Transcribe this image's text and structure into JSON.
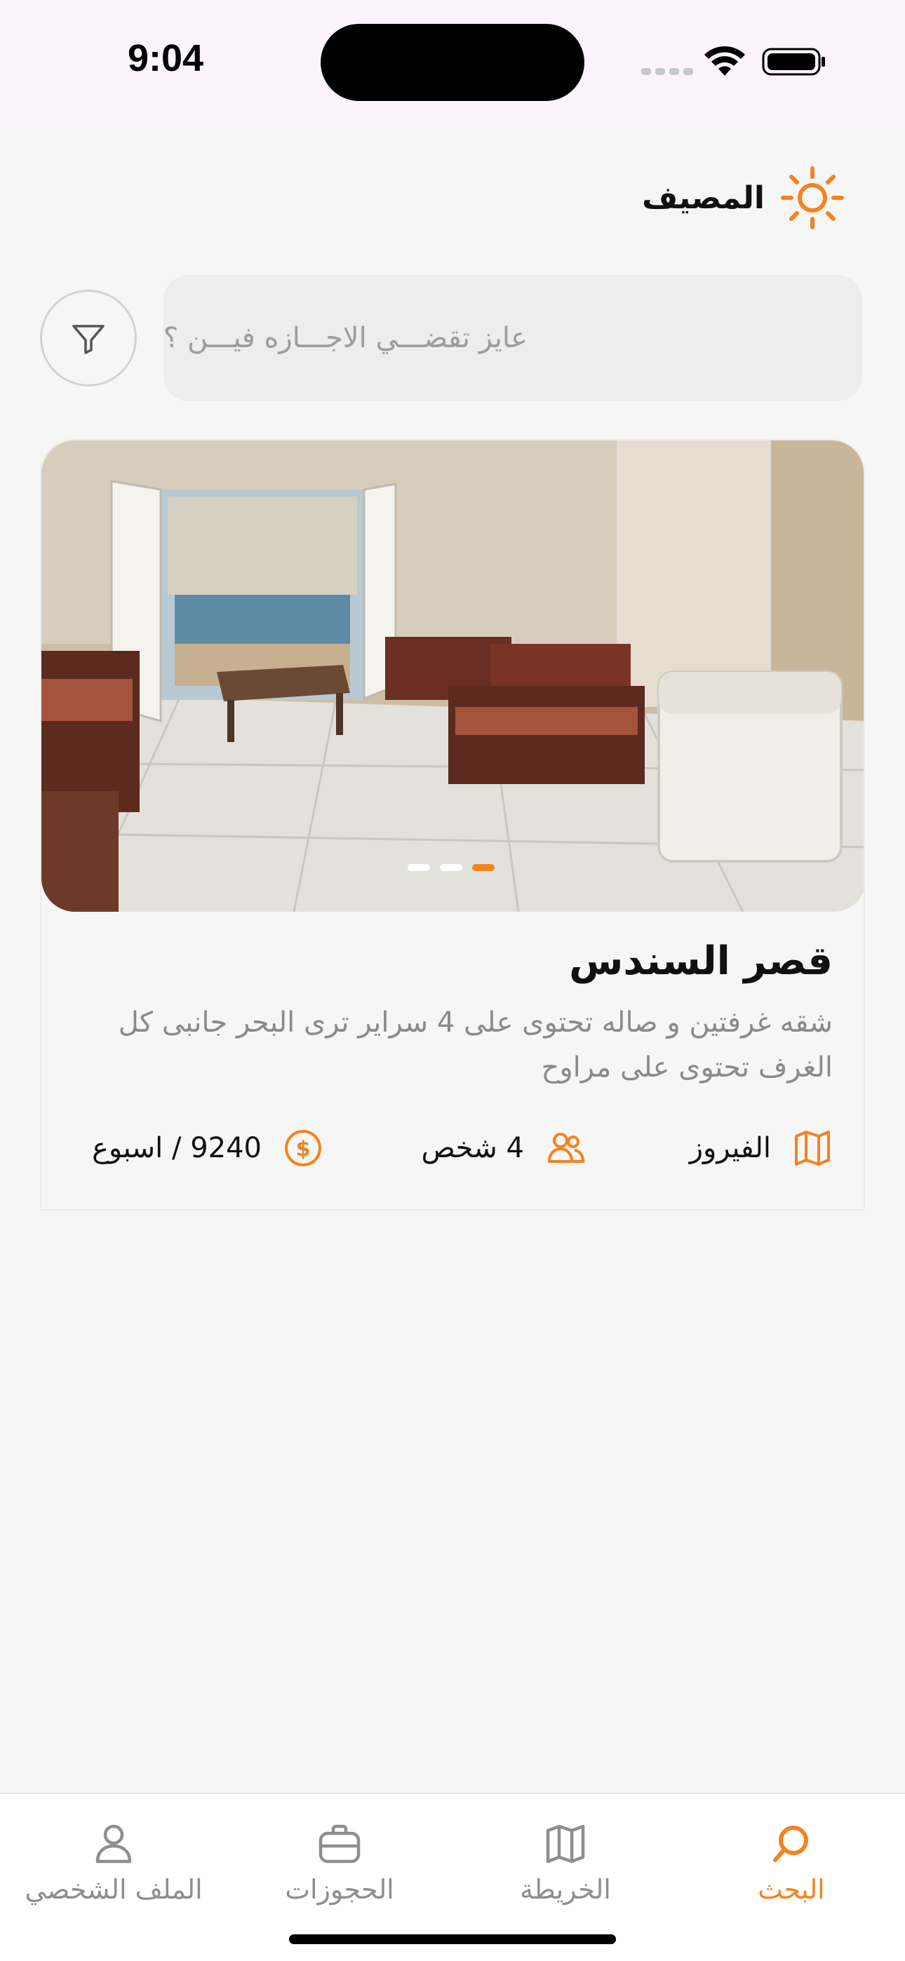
{
  "status_bar": {
    "time": "9:04"
  },
  "header": {
    "app_name": "المصيف",
    "logo_icon": "sun-icon"
  },
  "search": {
    "placeholder": "عايز تقضـــي الاجـــازه فيـــن ؟",
    "filter_icon": "filter-icon"
  },
  "listing": {
    "title": "قصر السندس",
    "description": "شقه غرفتين و صاله تحتوى على 4 سراير ترى البحر جانبى كل الغرف تحتوى على مراوح",
    "location": "الفيروز",
    "guests": "4 شخص",
    "price": "9240 / اسبوع",
    "carousel": {
      "count": 3,
      "active_index": 2
    }
  },
  "tabs": [
    {
      "label": "البحث",
      "icon": "search-icon",
      "active": true
    },
    {
      "label": "الخريطة",
      "icon": "map-icon",
      "active": false
    },
    {
      "label": "الحجوزات",
      "icon": "briefcase-icon",
      "active": false
    },
    {
      "label": "الملف الشخصي",
      "icon": "user-icon",
      "active": false
    }
  ],
  "colors": {
    "accent": "#f58220",
    "background": "#f6f6f6",
    "muted_text": "#8a8a8a"
  }
}
